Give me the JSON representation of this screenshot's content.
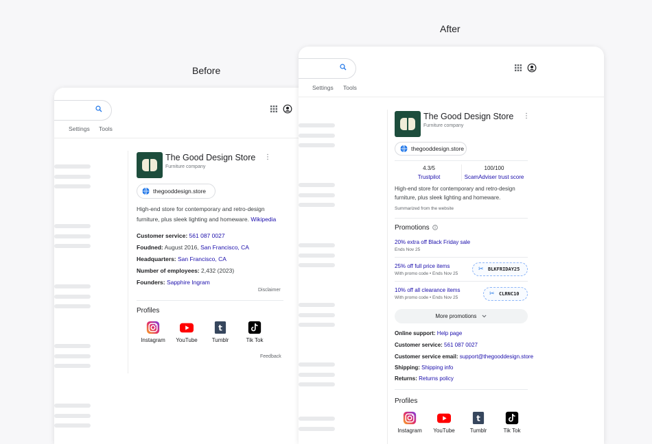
{
  "captions": {
    "before": "Before",
    "after": "After"
  },
  "before": {
    "tabs": [
      "Settings",
      "Tools"
    ],
    "panel": {
      "title": "The Good Design Store",
      "subtitle": "Furniture company",
      "website": "thegooddesign.store",
      "description": "High-end store for contemporary and retro-design furniture, plus sleek lighting and homeware.",
      "description_link": "Wikipedia",
      "facts": [
        {
          "label": "Customer service:",
          "value": "561 087 0027",
          "value_is_link": true,
          "suffix": ""
        },
        {
          "label": "Foudned:",
          "value": "August 2016, ",
          "value_is_link": false,
          "suffix": "San Francisco, CA"
        },
        {
          "label": "Headquarters:",
          "value": "San Francisco, CA",
          "value_is_link": true,
          "suffix": ""
        },
        {
          "label": "Number of employees:",
          "value": "2,432 (2023)",
          "value_is_link": false,
          "suffix": ""
        },
        {
          "label": "Founders:",
          "value": "Sapphire Ingram",
          "value_is_link": true,
          "suffix": ""
        }
      ],
      "disclaimer": "Disclaimer",
      "profiles_heading": "Profiles",
      "profiles": [
        "Instagram",
        "YouTube",
        "Tumblr",
        "Tik Tok"
      ],
      "feedback": "Feedback"
    }
  },
  "after": {
    "tabs": [
      "Settings",
      "Tools"
    ],
    "panel": {
      "title": "The Good Design Store",
      "subtitle": "Furniture company",
      "website": "thegooddesign.store",
      "ratings": [
        {
          "score": "4.3/5",
          "source": "Trustpilot"
        },
        {
          "score": "100/100",
          "source": "ScamAdviser trust score"
        }
      ],
      "description": "High-end store for contemporary and retro-design furniture, plus sleek lighting and homeware.",
      "summary_note": "Summarized from the website",
      "promotions_heading": "Promotions",
      "promotions": [
        {
          "title": "20% extra off Black Friday sale",
          "sub": "Ends Nov 25",
          "code": ""
        },
        {
          "title": "25% off full price items",
          "sub": "With promo code • Ends Nov 25",
          "code": "BLKFRIDAY25"
        },
        {
          "title": "10% off all clearance items",
          "sub": "With promo code • Ends Nov 25",
          "code": "CLRNC10"
        }
      ],
      "more_promotions": "More promotions",
      "facts": [
        {
          "label": "Online support:",
          "value": "Help page"
        },
        {
          "label": "Customer service:",
          "value": "561 087 0027"
        },
        {
          "label": "Customer service email:",
          "value": "support@thegooddesign.store"
        },
        {
          "label": "Shipping:",
          "value": "Shipping info"
        },
        {
          "label": "Returns:",
          "value": "Returns policy"
        }
      ],
      "profiles_heading": "Profiles",
      "profiles": [
        "Instagram",
        "YouTube",
        "Tumblr",
        "Tik Tok"
      ]
    }
  },
  "colors": {
    "link": "#1a0dab",
    "logo_bg": "#1d4d3c",
    "logo_fg": "#f1ecd8"
  },
  "icons": [
    "search-icon",
    "apps-grid-icon",
    "account-icon",
    "kebab-menu-icon",
    "globe-icon",
    "info-icon",
    "scissors-icon",
    "chevron-down-icon",
    "instagram-icon",
    "youtube-icon",
    "tumblr-icon",
    "tiktok-icon"
  ]
}
